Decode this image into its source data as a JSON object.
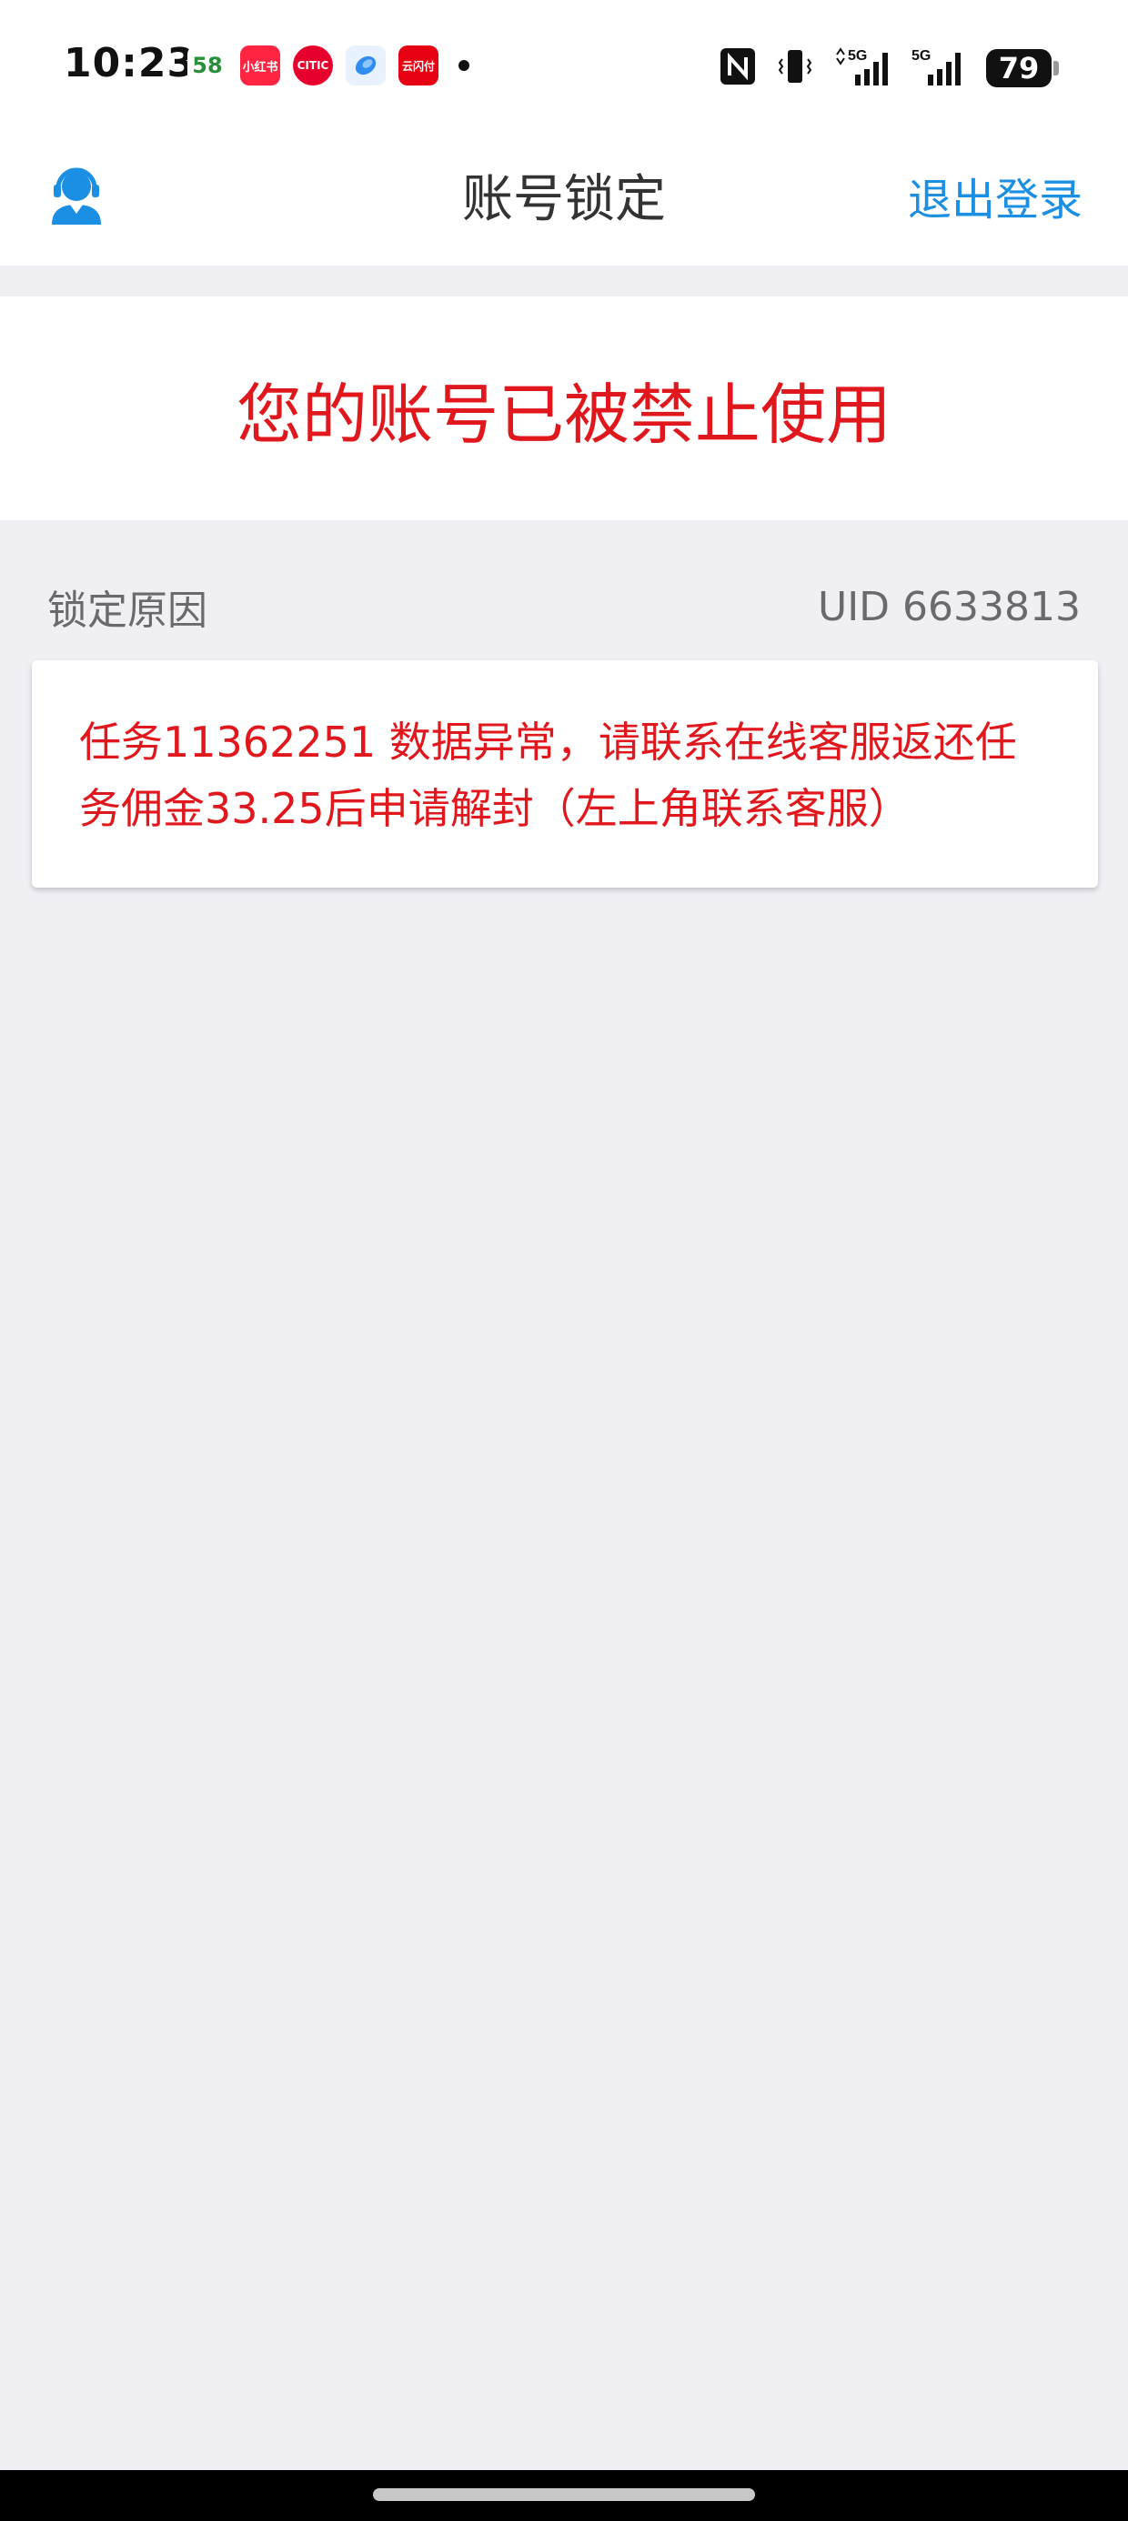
{
  "status_bar": {
    "time": "10:23",
    "notifications": [
      {
        "name": "58-app-icon",
        "glyph": "58"
      },
      {
        "name": "xiaohongshu-icon",
        "glyph": "小红书"
      },
      {
        "name": "citic-bank-icon",
        "glyph": "CITIC"
      },
      {
        "name": "browser-icon",
        "glyph": ""
      },
      {
        "name": "yunshanfu-icon",
        "glyph": "云闪付"
      }
    ],
    "network_1": "5G",
    "network_2": "5G",
    "battery": "79"
  },
  "nav": {
    "title": "账号锁定",
    "logout_label": "退出登录",
    "service_icon": "customer-service-icon"
  },
  "banner": {
    "message": "您的账号已被禁止使用"
  },
  "section": {
    "label": "锁定原因",
    "uid": "UID 6633813"
  },
  "reason": {
    "text": "任务11362251 数据异常，请联系在线客服返还任务佣金33.25后申请解封（左上角联系客服）"
  },
  "colors": {
    "accent": "#1a8fe3",
    "alert": "#e0171d",
    "background": "#efeff4"
  }
}
